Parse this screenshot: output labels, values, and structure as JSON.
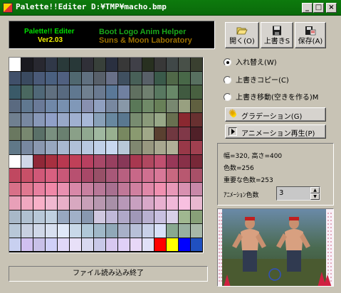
{
  "window": {
    "title": "Palette!!Editer D:¥TMP¥macho.bmp"
  },
  "banner": {
    "line1": "Palette!! Editer",
    "line2": "Ver2.03",
    "line3": "Boot Logo Anim Helper",
    "line4": "Suns & Moon Laboratory"
  },
  "toolbar": {
    "open_label": "開く(O)",
    "overwrite_label": "上書きS",
    "save_label": "保存(A)"
  },
  "modes": {
    "options": [
      {
        "label": "入れ替え(W)",
        "selected": true
      },
      {
        "label": "上書きコピー(C)",
        "selected": false
      },
      {
        "label": "上書き移動(空きを作る)M",
        "selected": false
      }
    ]
  },
  "actions": {
    "gradation_label": "グラデーション(G)",
    "anim_play_label": "アニメーション再生(P)"
  },
  "info": {
    "size_line": "幅=320, 高さ=400",
    "colors_line": "色数=256",
    "important_line": "重要な色数=253",
    "anim_colors_label": "ｱﾆﾒｰｼｮﾝ色数",
    "anim_colors_value": "3"
  },
  "status": {
    "message": "ファイル読み込み終了"
  },
  "colors": {
    "titlebar": "#0a6a0a",
    "face": "#c8c3b5",
    "banner_bg": "#000000"
  },
  "palette": {
    "rows": [
      [
        "#ffffff",
        "#1a1a20",
        "#282830",
        "#303848",
        "#2a3a3a",
        "#283838",
        "#303038",
        "#38403a",
        "#2a3040",
        "#383838",
        "#404048",
        "#283020",
        "#383838",
        "#404848",
        "#485048",
        "#3a4030"
      ],
      [
        "#40506a",
        "#3a4a60",
        "#4a5a78",
        "#4a6080",
        "#506080",
        "#506870",
        "#607080",
        "#58606a",
        "#687088",
        "#405060",
        "#486058",
        "#586068",
        "#3a5a4a",
        "#506848",
        "#486848",
        "#587060"
      ],
      [
        "#3a5a68",
        "#4a6860",
        "#506878",
        "#607080",
        "#586a80",
        "#607890",
        "#708090",
        "#6a7a90",
        "#5a7898",
        "#7080a0",
        "#607060",
        "#708070",
        "#587860",
        "#688868",
        "#405a40",
        "#486040"
      ],
      [
        "#5a6a80",
        "#607890",
        "#6a7a98",
        "#7088a8",
        "#7890b0",
        "#8098b8",
        "#8890b0",
        "#90a0c0",
        "#7888a0",
        "#8898a8",
        "#5a7858",
        "#708a68",
        "#688058",
        "#788870",
        "#98a080",
        "#606040"
      ],
      [
        "#708090",
        "#7888a0",
        "#8898b8",
        "#90a0c8",
        "#98a8c8",
        "#a0b0d0",
        "#a8b8d8",
        "#88a0b8",
        "#6888a0",
        "#5a7890",
        "#788c70",
        "#8a9a7a",
        "#98a888",
        "#687050",
        "#8a2830",
        "#683030"
      ],
      [
        "#6a7860",
        "#788870",
        "#5a7068",
        "#7a9080",
        "#6a8070",
        "#8aa088",
        "#90a890",
        "#a0b8a0",
        "#98b090",
        "#788860",
        "#8a9a70",
        "#a0a888",
        "#5a4030",
        "#703840",
        "#803848",
        "#502028"
      ],
      [
        "#607888",
        "#7888a0",
        "#8a98b0",
        "#98a8c0",
        "#a8b8d0",
        "#b0c0d8",
        "#b8c8e0",
        "#c0d0e8",
        "#c8d8f0",
        "#b8c8d8",
        "#808870",
        "#989880",
        "#a8a890",
        "#b0b098",
        "#983848",
        "#a04050"
      ],
      [
        "#ffffff",
        "#d0d8e8",
        "#902838",
        "#a83040",
        "#b83850",
        "#c04058",
        "#b84060",
        "#a84868",
        "#984060",
        "#883858",
        "#a83850",
        "#b04860",
        "#c05070",
        "#983858",
        "#883048",
        "#782838"
      ],
      [
        "#c04860",
        "#c85068",
        "#d05878",
        "#d86080",
        "#c85878",
        "#b85070",
        "#a84868",
        "#985068",
        "#a85878",
        "#b86080",
        "#c86888",
        "#d07090",
        "#d87898",
        "#c86880",
        "#b85870",
        "#a85068"
      ],
      [
        "#d87088",
        "#e07890",
        "#e880a0",
        "#f088a8",
        "#e890b0",
        "#d888a8",
        "#c880a0",
        "#b87898",
        "#a87090",
        "#c07898",
        "#d080a0",
        "#e088a8",
        "#f090b0",
        "#e898b8",
        "#d890b0",
        "#c888a8"
      ],
      [
        "#e8a0b8",
        "#f0a8c0",
        "#f8b0c8",
        "#f0b8d0",
        "#e8b0c8",
        "#d8a8c0",
        "#c8a0b8",
        "#b898b0",
        "#a890a8",
        "#b898b8",
        "#c8a0c0",
        "#d8a8c8",
        "#e8b0d0",
        "#f0b8d8",
        "#f8c0e0",
        "#e8b8d0"
      ],
      [
        "#a8b8c8",
        "#b0c0d0",
        "#b8c8d8",
        "#c0d0e0",
        "#98a8c0",
        "#a0b0c8",
        "#8898b0",
        "#d0c8e0",
        "#c0b8d8",
        "#b0a8c8",
        "#a098b8",
        "#b8b0d0",
        "#c8c0e0",
        "#d8d0e8",
        "#a0b890",
        "#88a078"
      ],
      [
        "#b8c8d8",
        "#c8d0e0",
        "#d0d8e8",
        "#d8e0f0",
        "#e0e8f8",
        "#c8d8e8",
        "#b0c8d8",
        "#a0b8c8",
        "#90a8b8",
        "#a8b0c8",
        "#b8c0d8",
        "#c8d0e8",
        "#d8e0f8",
        "#88a890",
        "#98b0a0",
        "#a8b8a8"
      ],
      [
        "#c8d0f0",
        "#d0c0f0",
        "#c8c0e8",
        "#d0d0f8",
        "#e0d8f8",
        "#e8e0f8",
        "#d8d8f0",
        "#c8c8e8",
        "#d8c8f0",
        "#e0d0f8",
        "#e8d8f8",
        "#e0e0f8",
        "#ff0000",
        "#ffff00",
        "#0000ff",
        "#2050c0"
      ]
    ]
  }
}
